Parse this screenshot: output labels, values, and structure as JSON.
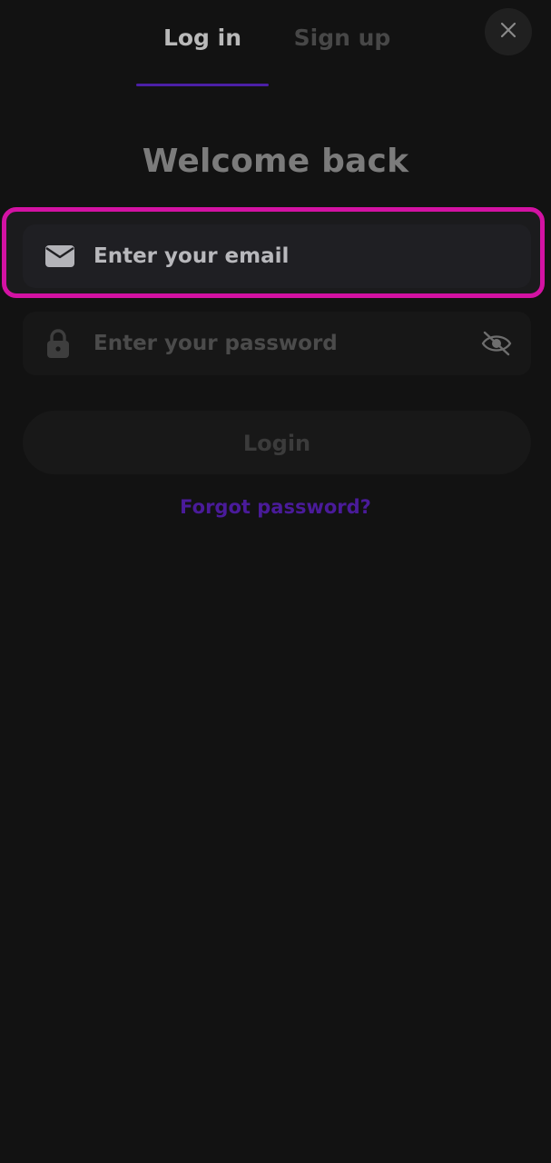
{
  "tabs": {
    "login_label": "Log in",
    "signup_label": "Sign up",
    "active": "login"
  },
  "close": {
    "icon": "close-icon"
  },
  "title": "Welcome back",
  "email": {
    "placeholder": "Enter your email",
    "value": "",
    "icon": "mail-icon"
  },
  "password": {
    "placeholder": "Enter your password",
    "value": "",
    "icon": "lock-icon",
    "toggle_icon": "eye-off-icon"
  },
  "login_button": {
    "label": "Login"
  },
  "forgot_password": {
    "label": "Forgot password?"
  },
  "colors": {
    "background": "#121212",
    "accent": "#4b1fa6",
    "highlight": "#d312a3"
  }
}
